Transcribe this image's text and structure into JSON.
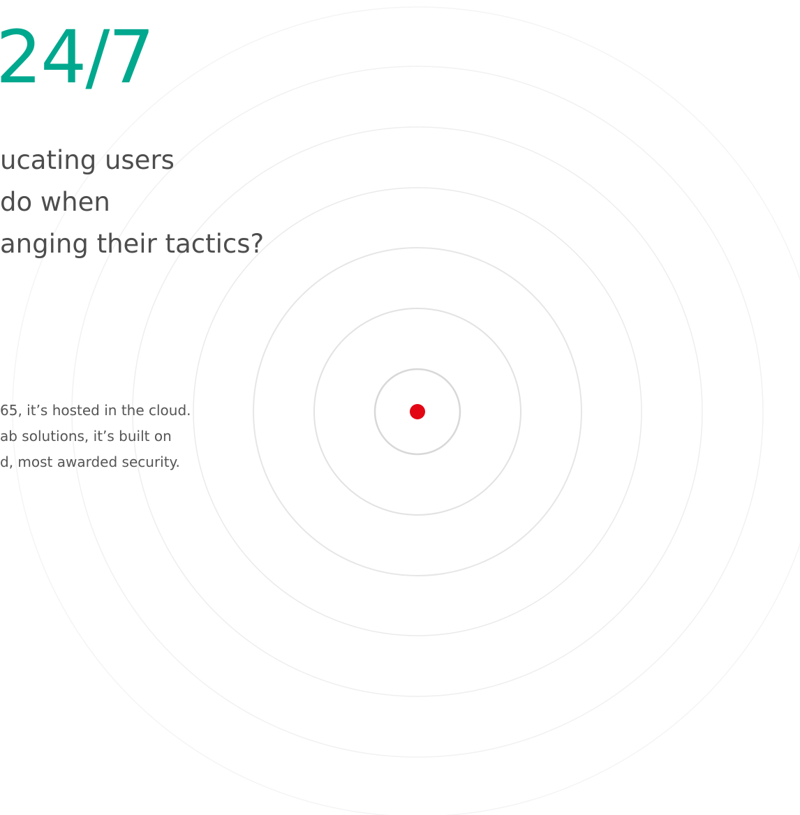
{
  "headline": "24/7",
  "question_lines": [
    "ucating users",
    "do when",
    "anging their tactics?"
  ],
  "body_lines": [
    "65, it’s hosted in the cloud.",
    "ab solutions, it’s built on",
    "d, most awarded security."
  ],
  "colors": {
    "accent": "#00a88e",
    "target_dot": "#e30613",
    "text": "#4d4d4d"
  },
  "graphic": {
    "icon": "radar-rings-icon",
    "ring_count": 7
  }
}
